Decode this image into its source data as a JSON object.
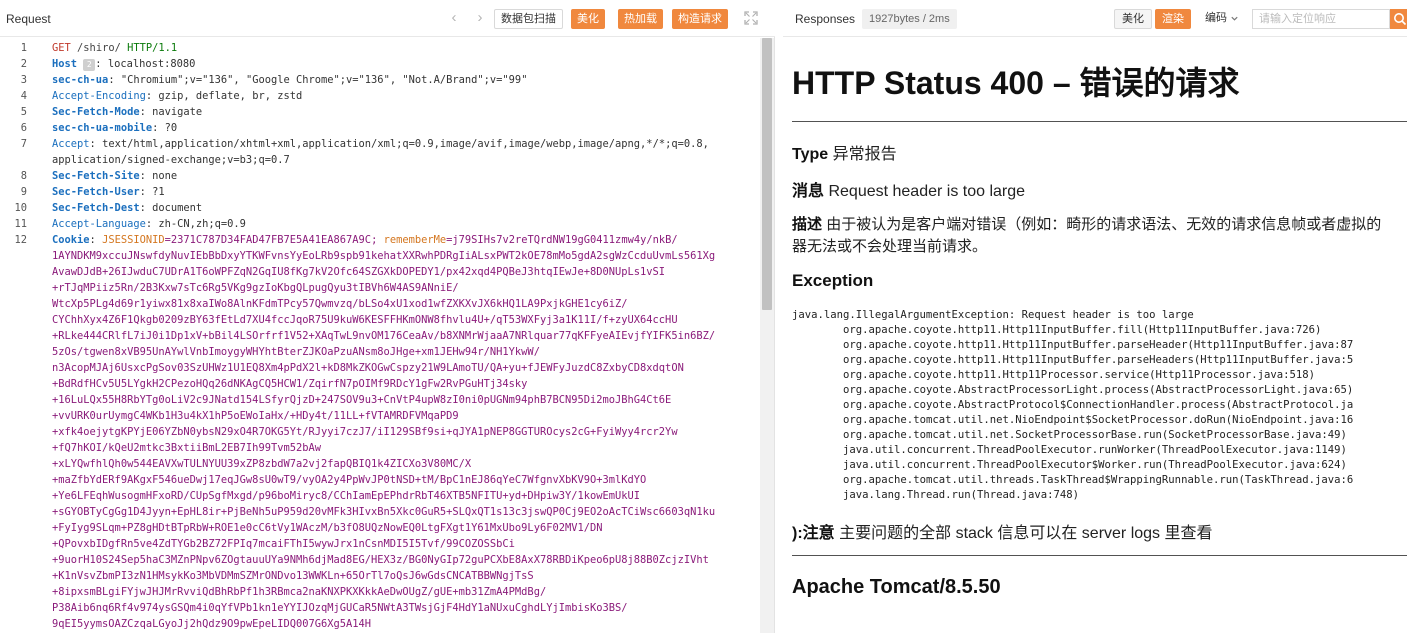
{
  "request": {
    "title": "Request",
    "scan_label": "数据包扫描",
    "beautify_label": "美化",
    "hot_load_label": "热加载",
    "build_request_label": "构造请求",
    "lines": [
      {
        "n": "1",
        "method": "GET",
        "path": "/shiro/",
        "proto": "HTTP/1.1"
      },
      {
        "n": "2",
        "name": "Host",
        "badge": "2",
        "value": "localhost:8080"
      },
      {
        "n": "3",
        "name": "sec-ch-ua",
        "value": "\"Chromium\";v=\"136\", \"Google Chrome\";v=\"136\", \"Not.A/Brand\";v=\"99\""
      },
      {
        "n": "4",
        "name": "Accept-Encoding",
        "value": "gzip, deflate, br, zstd"
      },
      {
        "n": "5",
        "name": "Sec-Fetch-Mode",
        "value": "navigate"
      },
      {
        "n": "6",
        "name": "sec-ch-ua-mobile",
        "value": "?0"
      },
      {
        "n": "7",
        "name": "Accept",
        "value": "text/html,application/xhtml+xml,application/xml;q=0.9,image/avif,image/webp,image/apng,*/*;q=0.8,",
        "cont": "application/signed-exchange;v=b3;q=0.7"
      },
      {
        "n": "8",
        "name": "Sec-Fetch-Site",
        "value": "none"
      },
      {
        "n": "9",
        "name": "Sec-Fetch-User",
        "value": "?1"
      },
      {
        "n": "10",
        "name": "Sec-Fetch-Dest",
        "value": "document"
      },
      {
        "n": "11",
        "name": "Accept-Language",
        "value": "zh-CN,zh;q=0.9"
      }
    ],
    "cookie": {
      "n": "12",
      "name": "Cookie",
      "session_name": "JSESSIONID",
      "session_value": "=2371C787D34FAD47FB7E5A41EA867A9C;",
      "remember_name": "rememberMe",
      "first_value": "=j79SIHs7v2reTQrdNW19gG0411zmw4y/nkB/",
      "rows": [
        "1AYNDKM9xccuJNswfdyNuvIEbBbDxyYTKWFvnsYyEoLRb9spb91kehatXXRwhPDRgIiALsxPWT2kOE78mMo5gdA2sgWzCcduUvmLs561Xg",
        "AvawDJdB+26IJwduC7UDrA1T6oWPFZqN2GqIU8fKg7kV2Ofc64SZGXkDOPEDY1/px42xqd4PQBeJ3htqIEwJe+8D0NUpLs1vSI",
        "+rTJqMPiiz5Rn/2B3Kxw7sTc6Rg5VKg9gzIoKbgQLpugQyu3tIBVh6W4AS9ANniE/",
        "WtcXp5PLg4d69r1yiwx81x8xaIWo8AlnKFdmTPcy57Qwmvzq/bLSo4xU1xod1wfZXKXvJX6kHQ1LA9PxjkGHE1cy6iZ/",
        "CYChhXyx4Z6F1Qkgb0209zBY63fEtLd7XU4fccJqoR75U9kuW6KESFFHKmONW8fhvlu4U+/qT53WXFyj3a1K11I/f+zyUX64ccHU",
        "+RLke444CRlfL7iJ0i1Dp1xV+bBil4LSOrfrf1V52+XAqTwL9nvOM176CeaAv/b8XNMrWjaaA7NRlquar77qKFFyeAIEvjfYIFK5in6BZ/",
        "5zOs/tgwen8xVB95UnAYwlVnbImoygyWHYhtBterZJKOaPzuANsm8oJHge+xm1JEHw94r/NH1YkwW/",
        "n3AcopMJAj6UsxcPgSov03SzUHWz1U1EQ8Xm4pPdX2l+kD8MkZKOGwCspzy21W9LAmoTU/QA+yu+fJEWFyJuzdC8ZxbyCD8xdqtON",
        "+BdRdfHCv5U5LYgkH2CPezoHQq26dNKAgCQ5HCW1/ZqirfN7pOIMf9RDcY1gFw2RvPGuHTj34sky",
        "+16LuLQx55H8RbYTg0oLiV2c9JNatd154LSfyrQjzD+247SOV9u3+CnVtP4upW8zI0ni0pUGNm94phB7BCN95Di2moJBhG4Ct6E",
        "+vvURK0urUymgC4WKb1H3u4kX1hP5oEWoIaHx/+HDy4t/11LL+fVTAMRDFVMqaPD9",
        "+xfk4oejytgKPYjE06YZbN0ybsN29xO4R7OKG5Yt/RJyyi7czJ7/iI129SBf9si+qJYA1pNEP8GGTUROcys2cG+FyiWyy4rcr2Yw",
        "+fQ7hKOI/kQeU2mtkc3BxtiiBmL2EB7Ih99Tvm52bAw",
        "+xLYQwfhlQh0w544EAVXwTULNYUU39xZP8zbdW7a2vj2fapQBIQ1k4ZICXo3V80MC/X",
        "+maZfbYdERf9AKgxF546ueDwj17eqJGw8sU0wT9/vyOA2y4PpWvJP0tNSD+tM/BpC1nEJ86qYeC7WfgnvXbKV9O+3mlKdYO",
        "+Ye6LFEqhWusogmHFxoRD/CUpSgfMxgd/p96boMiryc8/CChIamEpEPhdrRbT46XTB5NFITU+yd+DHpiw3Y/1kowEmUkUI",
        "+sGYOBTyCgGg1D4Jyyn+EpHL8ir+PjBeNh5uP959d20vMFk3HIvxBn5Xkc0GuR5+SLQxQT1s13c3jswQP0Cj9EO2oAcTCiWsc6603qN1ku",
        "+FyIyg9SLqm+PZ8gHDtBTpRbW+ROE1e0cC6tVy1WAczM/b3fO8UQzNowEQ0LtgFXgt1Y61MxUbo9Ly6F02MV1/DN",
        "+QPovxbIDgfRn5ve4ZdTYGb2BZ72FPIq7mcaiFThI5wywJrx1nCsnMDI5I5Tvf/99COZOSSbCi",
        "+9uorH10S24Sep5haC3MZnPNpv6ZOgtauuUYa9NMh6djMad8EG/HEX3z/BG0NyGIp72guPCXbE8AxX78RBDiKpeo6pU8j88B0ZcjzIVht",
        "+K1nVsvZbmPI3zN1HMsykKo3MbVDMmSZMrONDvo13WWKLn+65OrTl7oQsJ6wGdsCNCATBBWNgjTsS",
        "+8ipxsmBLgiFYjwJHJMrRvviQdBhRbPf1h3RBmca2naKNXPKXKkkAeDwOUgZ/gUE+mb31ZmA4PMdBg/",
        "P38Aib6nq6Rf4v974ysGSQm4i0qYfVPb1kn1eYYIJOzqMjGUCaR5NWtA3TWsjGjF4HdY1aNUxuCghdLYjImbisKo3BS/",
        "9qEI5yymsOAZCzqaLGyoJj2hQdz9O9pwEpeLIDQ007G6Xg5A14H"
      ]
    }
  },
  "response": {
    "title": "Responses",
    "size": "1927bytes / 2ms",
    "beautify_label": "美化",
    "render_label": "渲染",
    "encoding_label": "编码",
    "search_placeholder": "请输入定位响应",
    "h1": "HTTP Status 400 – 错误的请求",
    "type_label": "Type",
    "type_value": "异常报告",
    "message_label": "消息",
    "message_value": "Request header is too large",
    "desc_label": "描述",
    "desc_value_1": "由于被认为是客户端对错误（例如：畸形的请求语法、无效的请求信息帧或者虚拟的",
    "desc_value_2": "器无法或不会处理当前请求。",
    "exception_label": "Exception",
    "stack": [
      "java.lang.IllegalArgumentException: Request header is too large",
      "\torg.apache.coyote.http11.Http11InputBuffer.fill(Http11InputBuffer.java:726)",
      "\torg.apache.coyote.http11.Http11InputBuffer.parseHeader(Http11InputBuffer.java:87",
      "\torg.apache.coyote.http11.Http11InputBuffer.parseHeaders(Http11InputBuffer.java:5",
      "\torg.apache.coyote.http11.Http11Processor.service(Http11Processor.java:518)",
      "\torg.apache.coyote.AbstractProcessorLight.process(AbstractProcessorLight.java:65)",
      "\torg.apache.coyote.AbstractProtocol$ConnectionHandler.process(AbstractProtocol.ja",
      "\torg.apache.tomcat.util.net.NioEndpoint$SocketProcessor.doRun(NioEndpoint.java:16",
      "\torg.apache.tomcat.util.net.SocketProcessorBase.run(SocketProcessorBase.java:49)",
      "\tjava.util.concurrent.ThreadPoolExecutor.runWorker(ThreadPoolExecutor.java:1149)",
      "\tjava.util.concurrent.ThreadPoolExecutor$Worker.run(ThreadPoolExecutor.java:624)",
      "\torg.apache.tomcat.util.threads.TaskThread$WrappingRunnable.run(TaskThread.java:6",
      "\tjava.lang.Thread.run(Thread.java:748)"
    ],
    "note_label": "):注意",
    "note_value": "主要问题的全部 stack 信息可以在 server logs 里查看",
    "footer": "Apache Tomcat/8.5.50"
  },
  "colors": {
    "accent": "#f0883e",
    "header_name": "#1b6fbe",
    "cookie_value": "#8a1a7a",
    "method": "#c0392b",
    "protocol": "#0a7a0a"
  },
  "icons": {
    "prev": "chevron-left-icon",
    "next": "chevron-right-icon",
    "expand": "expand-icon",
    "search": "search-icon",
    "dropdown": "chevron-down-icon"
  }
}
